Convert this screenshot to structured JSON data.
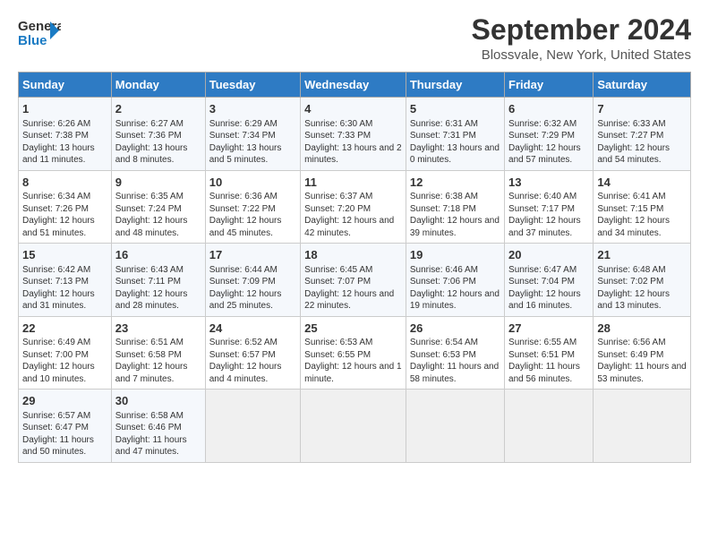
{
  "logo": {
    "line1": "General",
    "line2": "Blue"
  },
  "title": "September 2024",
  "subtitle": "Blossvale, New York, United States",
  "days_of_week": [
    "Sunday",
    "Monday",
    "Tuesday",
    "Wednesday",
    "Thursday",
    "Friday",
    "Saturday"
  ],
  "weeks": [
    [
      {
        "day": "1",
        "info": "Sunrise: 6:26 AM\nSunset: 7:38 PM\nDaylight: 13 hours and 11 minutes."
      },
      {
        "day": "2",
        "info": "Sunrise: 6:27 AM\nSunset: 7:36 PM\nDaylight: 13 hours and 8 minutes."
      },
      {
        "day": "3",
        "info": "Sunrise: 6:29 AM\nSunset: 7:34 PM\nDaylight: 13 hours and 5 minutes."
      },
      {
        "day": "4",
        "info": "Sunrise: 6:30 AM\nSunset: 7:33 PM\nDaylight: 13 hours and 2 minutes."
      },
      {
        "day": "5",
        "info": "Sunrise: 6:31 AM\nSunset: 7:31 PM\nDaylight: 13 hours and 0 minutes."
      },
      {
        "day": "6",
        "info": "Sunrise: 6:32 AM\nSunset: 7:29 PM\nDaylight: 12 hours and 57 minutes."
      },
      {
        "day": "7",
        "info": "Sunrise: 6:33 AM\nSunset: 7:27 PM\nDaylight: 12 hours and 54 minutes."
      }
    ],
    [
      {
        "day": "8",
        "info": "Sunrise: 6:34 AM\nSunset: 7:26 PM\nDaylight: 12 hours and 51 minutes."
      },
      {
        "day": "9",
        "info": "Sunrise: 6:35 AM\nSunset: 7:24 PM\nDaylight: 12 hours and 48 minutes."
      },
      {
        "day": "10",
        "info": "Sunrise: 6:36 AM\nSunset: 7:22 PM\nDaylight: 12 hours and 45 minutes."
      },
      {
        "day": "11",
        "info": "Sunrise: 6:37 AM\nSunset: 7:20 PM\nDaylight: 12 hours and 42 minutes."
      },
      {
        "day": "12",
        "info": "Sunrise: 6:38 AM\nSunset: 7:18 PM\nDaylight: 12 hours and 39 minutes."
      },
      {
        "day": "13",
        "info": "Sunrise: 6:40 AM\nSunset: 7:17 PM\nDaylight: 12 hours and 37 minutes."
      },
      {
        "day": "14",
        "info": "Sunrise: 6:41 AM\nSunset: 7:15 PM\nDaylight: 12 hours and 34 minutes."
      }
    ],
    [
      {
        "day": "15",
        "info": "Sunrise: 6:42 AM\nSunset: 7:13 PM\nDaylight: 12 hours and 31 minutes."
      },
      {
        "day": "16",
        "info": "Sunrise: 6:43 AM\nSunset: 7:11 PM\nDaylight: 12 hours and 28 minutes."
      },
      {
        "day": "17",
        "info": "Sunrise: 6:44 AM\nSunset: 7:09 PM\nDaylight: 12 hours and 25 minutes."
      },
      {
        "day": "18",
        "info": "Sunrise: 6:45 AM\nSunset: 7:07 PM\nDaylight: 12 hours and 22 minutes."
      },
      {
        "day": "19",
        "info": "Sunrise: 6:46 AM\nSunset: 7:06 PM\nDaylight: 12 hours and 19 minutes."
      },
      {
        "day": "20",
        "info": "Sunrise: 6:47 AM\nSunset: 7:04 PM\nDaylight: 12 hours and 16 minutes."
      },
      {
        "day": "21",
        "info": "Sunrise: 6:48 AM\nSunset: 7:02 PM\nDaylight: 12 hours and 13 minutes."
      }
    ],
    [
      {
        "day": "22",
        "info": "Sunrise: 6:49 AM\nSunset: 7:00 PM\nDaylight: 12 hours and 10 minutes."
      },
      {
        "day": "23",
        "info": "Sunrise: 6:51 AM\nSunset: 6:58 PM\nDaylight: 12 hours and 7 minutes."
      },
      {
        "day": "24",
        "info": "Sunrise: 6:52 AM\nSunset: 6:57 PM\nDaylight: 12 hours and 4 minutes."
      },
      {
        "day": "25",
        "info": "Sunrise: 6:53 AM\nSunset: 6:55 PM\nDaylight: 12 hours and 1 minute."
      },
      {
        "day": "26",
        "info": "Sunrise: 6:54 AM\nSunset: 6:53 PM\nDaylight: 11 hours and 58 minutes."
      },
      {
        "day": "27",
        "info": "Sunrise: 6:55 AM\nSunset: 6:51 PM\nDaylight: 11 hours and 56 minutes."
      },
      {
        "day": "28",
        "info": "Sunrise: 6:56 AM\nSunset: 6:49 PM\nDaylight: 11 hours and 53 minutes."
      }
    ],
    [
      {
        "day": "29",
        "info": "Sunrise: 6:57 AM\nSunset: 6:47 PM\nDaylight: 11 hours and 50 minutes."
      },
      {
        "day": "30",
        "info": "Sunrise: 6:58 AM\nSunset: 6:46 PM\nDaylight: 11 hours and 47 minutes."
      },
      {
        "day": "",
        "info": ""
      },
      {
        "day": "",
        "info": ""
      },
      {
        "day": "",
        "info": ""
      },
      {
        "day": "",
        "info": ""
      },
      {
        "day": "",
        "info": ""
      }
    ]
  ]
}
